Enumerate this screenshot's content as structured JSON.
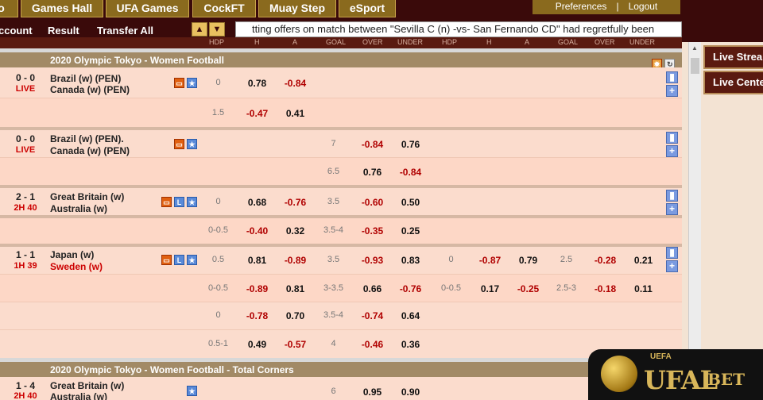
{
  "nav": {
    "tabs": [
      "o",
      "Games Hall",
      "UFA Games",
      "CockFT",
      "Muay Step",
      "eSport"
    ],
    "preferences": "Preferences",
    "separator": "|",
    "logout": "Logout"
  },
  "subbar": {
    "links": [
      "ccount",
      "Result",
      "Transfer All"
    ],
    "ticker": "tting offers on match between \"Sevilla C (n) -vs- San Fernando CD\" had regretfully been"
  },
  "columns": [
    "HDP",
    "H",
    "A",
    "GOAL",
    "OVER",
    "UNDER",
    "HDP",
    "H",
    "A",
    "GOAL",
    "OVER",
    "UNDER"
  ],
  "leagues": [
    {
      "title": "2020 Olympic Tokyo - Women Football"
    },
    {
      "title": "2020 Olympic Tokyo - Women Football - Total Corners"
    }
  ],
  "matches": [
    {
      "score": "0 - 0",
      "status": "LIVE",
      "home": "Brazil (w) (PEN)",
      "away": "Canada (w) (PEN)",
      "main": {
        "hdp": "0",
        "h": "0.78",
        "a": "-0.84"
      },
      "sub": {
        "hdp": "1.5",
        "h": "-0.47",
        "a": "0.41"
      }
    },
    {
      "score": "0 - 0",
      "status": "LIVE",
      "home": "Brazil (w) (PEN).",
      "away": "Canada (w) (PEN)",
      "main": {
        "goal": "7",
        "over": "-0.84",
        "under": "0.76"
      },
      "sub": {
        "goal": "6.5",
        "over": "0.76",
        "under": "-0.84"
      }
    },
    {
      "score": "2 - 1",
      "status": "2H 40",
      "home": "Great Britain (w)",
      "away": "Australia (w)",
      "main": {
        "hdp": "0",
        "h": "0.68",
        "a": "-0.76",
        "goal": "3.5",
        "over": "-0.60",
        "under": "0.50"
      },
      "sub": {
        "hdp": "0-0.5",
        "h": "-0.40",
        "a": "0.32",
        "goal": "3.5-4",
        "over": "-0.35",
        "under": "0.25"
      }
    },
    {
      "score": "1 - 1",
      "status": "1H 39",
      "home": "Japan (w)",
      "away": "Sweden (w)",
      "main": {
        "hdp": "0.5",
        "h": "0.81",
        "a": "-0.89",
        "goal": "3.5",
        "over": "-0.93",
        "under": "0.83",
        "hdp1": "0",
        "h1": "-0.87",
        "a1": "0.79",
        "goal1": "2.5",
        "over1": "-0.28",
        "under1": "0.21"
      },
      "sub1": {
        "hdp": "0-0.5",
        "h": "-0.89",
        "a": "0.81",
        "goal": "3-3.5",
        "over": "0.66",
        "under": "-0.76",
        "hdp1": "0-0.5",
        "h1": "0.17",
        "a1": "-0.25",
        "goal1": "2.5-3",
        "over1": "-0.18",
        "under1": "0.11"
      },
      "sub2": {
        "hdp": "0",
        "h": "-0.78",
        "a": "0.70",
        "goal": "3.5-4",
        "over": "-0.74",
        "under": "0.64"
      },
      "sub3": {
        "hdp": "0.5-1",
        "h": "0.49",
        "a": "-0.57",
        "goal": "4",
        "over": "-0.46",
        "under": "0.36"
      }
    },
    {
      "score": "1 - 4",
      "status": "2H 40",
      "home": "Great Britain (w)",
      "away": "Australia (w)",
      "main": {
        "goal": "6",
        "over": "0.95",
        "under": "0.90"
      }
    }
  ],
  "right_panel": {
    "live_stream": "Live Stream",
    "live_center": "Live Center"
  },
  "logo": {
    "uefa": "UEFA",
    "brand": "UFAL",
    "brand2": "BET"
  },
  "colors": {
    "dark": "#3a0a0a",
    "gold": "#8a6a1e",
    "league": "#a28a66",
    "row": "#fbdccd",
    "red": "#b00000"
  }
}
